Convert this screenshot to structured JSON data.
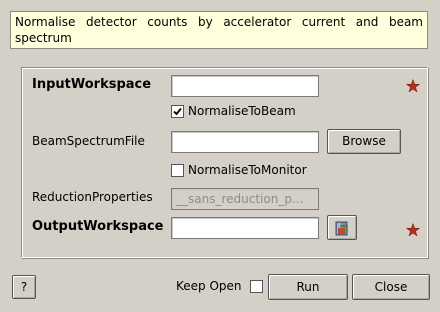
{
  "description": "Normalise detector counts by accelerator current and beam spectrum",
  "form": {
    "input_workspace": {
      "label": "InputWorkspace",
      "value": ""
    },
    "normalise_to_beam": {
      "label": "NormaliseToBeam",
      "checked": true
    },
    "beam_spectrum_file": {
      "label": "BeamSpectrumFile",
      "value": "",
      "browse_label": "Browse"
    },
    "normalise_to_monitor": {
      "label": "NormaliseToMonitor",
      "checked": false
    },
    "reduction_properties": {
      "label": "ReductionProperties",
      "value": "__sans_reduction_p..."
    },
    "output_workspace": {
      "label": "OutputWorkspace",
      "value": ""
    }
  },
  "footer": {
    "help_label": "?",
    "keep_open_label": "Keep Open",
    "keep_open_checked": false,
    "run_label": "Run",
    "close_label": "Close"
  },
  "colors": {
    "mandatory_star": "#b03018",
    "tooltip_bg": "#ffffdc"
  },
  "icons": {
    "mandatory": "red-star-icon",
    "workspace_picker": "workspace-picker-icon"
  }
}
